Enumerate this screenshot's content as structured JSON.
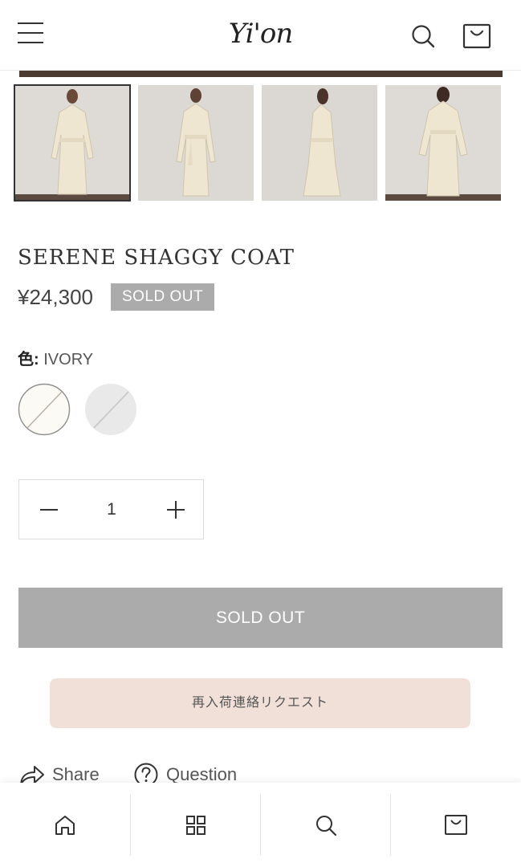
{
  "header": {
    "logo": "Yi'on",
    "menu_icon": "hamburger-menu-icon",
    "search_icon": "search-icon",
    "bag_icon": "shopping-bag-icon"
  },
  "gallery": {
    "thumbnails": [
      {
        "view": "front",
        "active": true
      },
      {
        "view": "front-belted",
        "active": false
      },
      {
        "view": "side",
        "active": false
      },
      {
        "view": "back",
        "active": false
      }
    ]
  },
  "product": {
    "title": "SERENE SHAGGY COAT",
    "price": "¥24,300",
    "sold_badge": "SOLD OUT"
  },
  "color": {
    "label": "色:",
    "selected": "IVORY",
    "swatches": [
      {
        "name": "ivory",
        "color": "#fbfaf4",
        "selected": true,
        "sold_out": true
      },
      {
        "name": "light-gray",
        "color": "#e9e9e9",
        "selected": false,
        "sold_out": true
      }
    ]
  },
  "quantity": {
    "value": "1",
    "minus_icon": "minus-icon",
    "plus_icon": "plus-icon"
  },
  "actions": {
    "sold_out_button": "SOLD OUT",
    "restock_button": "再入荷連絡リクエスト",
    "share_label": "Share",
    "question_label": "Question"
  },
  "tabbar": {
    "items": [
      "home-icon",
      "category-grid-icon",
      "search-icon",
      "shopping-bag-icon"
    ]
  },
  "colors": {
    "sold_out_gray": "#ababab",
    "restock_bg": "#f0e0d8",
    "text": "#333333"
  }
}
